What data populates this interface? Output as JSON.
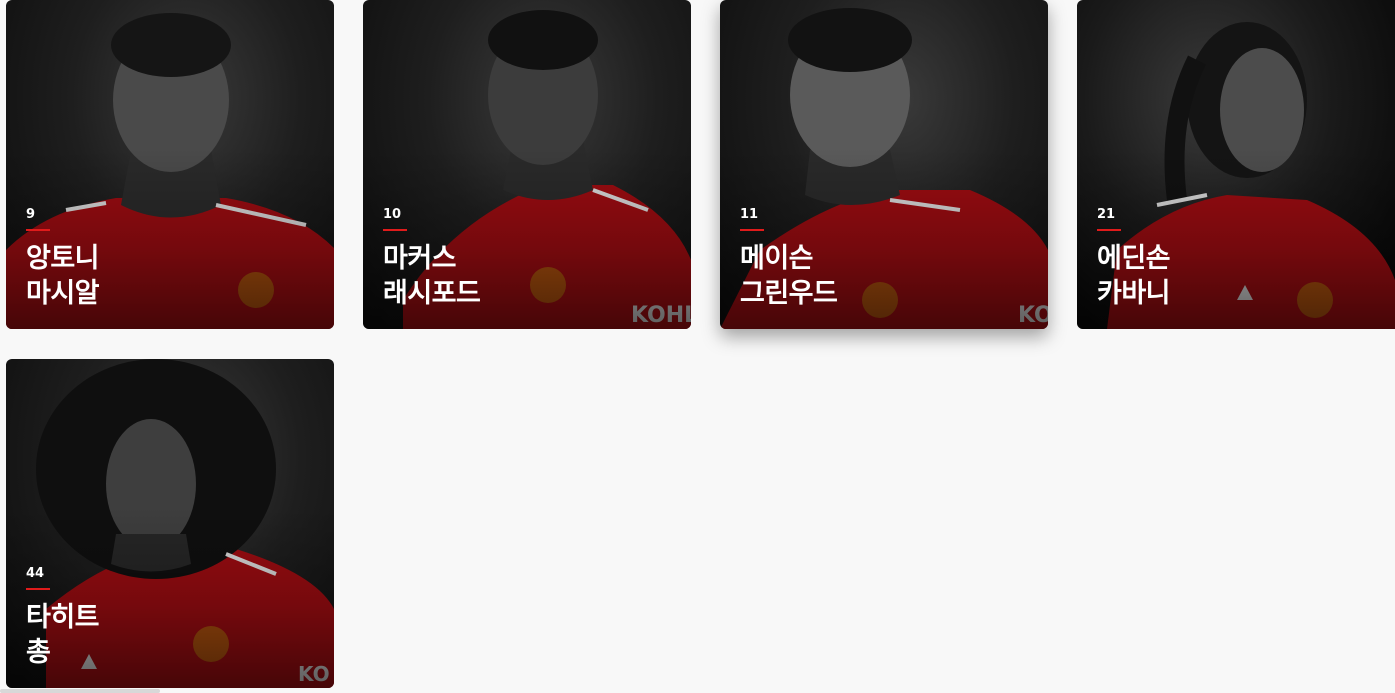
{
  "players": [
    {
      "number": "9",
      "name_line1": "앙토니",
      "name_line2": "마시알"
    },
    {
      "number": "10",
      "name_line1": "마커스",
      "name_line2": "래시포드"
    },
    {
      "number": "11",
      "name_line1": "메이슨",
      "name_line2": "그린우드"
    },
    {
      "number": "21",
      "name_line1": "에딘손",
      "name_line2": "카바니"
    },
    {
      "number": "44",
      "name_line1": "타히트",
      "name_line2": "총"
    }
  ],
  "colors": {
    "page_background": "#f8f8f8",
    "card_background": "#1e1e1e",
    "accent_red": "#e01b1b",
    "shirt_red": "#a50d12",
    "text": "#ffffff"
  },
  "icons": [
    "player-photo",
    "club-crest-icon",
    "sponsor-logo",
    "kit-brand-icon"
  ]
}
